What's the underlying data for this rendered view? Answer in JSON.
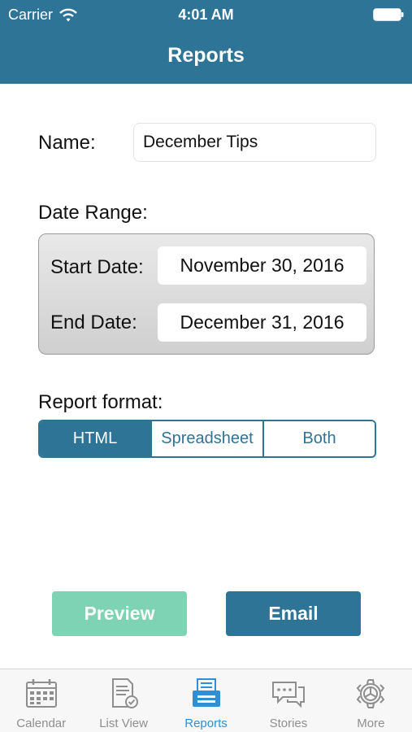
{
  "status_bar": {
    "carrier": "Carrier",
    "time": "4:01 AM"
  },
  "nav": {
    "title": "Reports"
  },
  "form": {
    "name_label": "Name:",
    "name_value": "December Tips",
    "date_range_label": "Date Range:",
    "start_label": "Start Date:",
    "start_value": "November 30, 2016",
    "end_label": "End Date:",
    "end_value": "December 31, 2016",
    "format_label": "Report format:",
    "format_options": [
      "HTML",
      "Spreadsheet",
      "Both"
    ],
    "format_selected": "HTML"
  },
  "actions": {
    "preview": "Preview",
    "email": "Email"
  },
  "tabbar": {
    "items": [
      {
        "label": "Calendar",
        "icon": "calendar-icon"
      },
      {
        "label": "List View",
        "icon": "list-view-icon"
      },
      {
        "label": "Reports",
        "icon": "reports-icon"
      },
      {
        "label": "Stories",
        "icon": "stories-icon"
      },
      {
        "label": "More",
        "icon": "more-gear-icon"
      }
    ],
    "active": "Reports"
  },
  "colors": {
    "brand": "#2e7496",
    "preview_button": "#7dd3b4",
    "active_tab": "#2f8fd6",
    "inactive_tab": "#8e8e8e"
  }
}
